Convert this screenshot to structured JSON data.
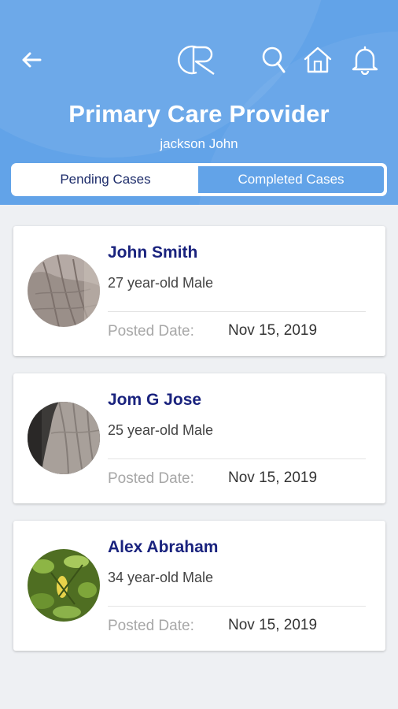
{
  "header": {
    "title": "Primary Care Provider",
    "subtitle": "jackson John",
    "logo_text": "CR",
    "icons": [
      "back-arrow-icon",
      "search-icon",
      "home-icon",
      "bell-icon"
    ],
    "colors": {
      "background": "#62a3e8",
      "accent": "#1a237e"
    }
  },
  "tabs": {
    "pending": "Pending Cases",
    "completed": "Completed Cases",
    "selected": "Pending Cases"
  },
  "cases": [
    {
      "name": "John Smith",
      "age_gender": "27 year-old Male",
      "posted_label": "Posted Date:",
      "posted_date": "Nov 15, 2019"
    },
    {
      "name": "Jom G Jose",
      "age_gender": "25 year-old Male",
      "posted_label": "Posted Date:",
      "posted_date": "Nov 15, 2019"
    },
    {
      "name": "Alex Abraham",
      "age_gender": "34 year-old Male",
      "posted_label": "Posted Date:",
      "posted_date": "Nov 15, 2019"
    }
  ]
}
